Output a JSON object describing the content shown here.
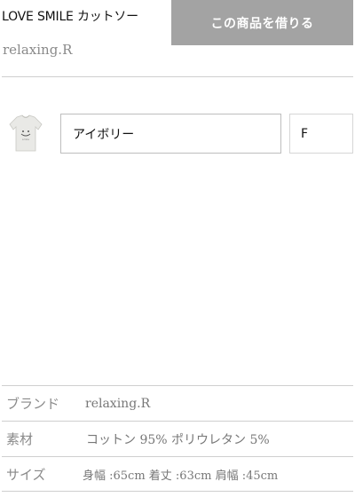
{
  "product": {
    "title": "LOVE SMILE カットソー",
    "brand": "relaxing.R",
    "rent_button_label": "この商品を借りる"
  },
  "variant": {
    "thumbnail_icon": "tshirt-thumbnail-icon",
    "color_value": "アイボリー",
    "size_value": "F"
  },
  "specs": [
    {
      "label": "ブランド",
      "value": "relaxing.R"
    },
    {
      "label": "素材",
      "value": "コットン 95% ポリウレタン 5%"
    },
    {
      "label": "サイズ",
      "value": "身幅 :65cm 着丈 :63cm 肩幅 :45cm"
    }
  ],
  "colors": {
    "button_bg": "#a3a3a3",
    "divider": "#cfcfcf",
    "muted_text": "#8a8a8a"
  }
}
